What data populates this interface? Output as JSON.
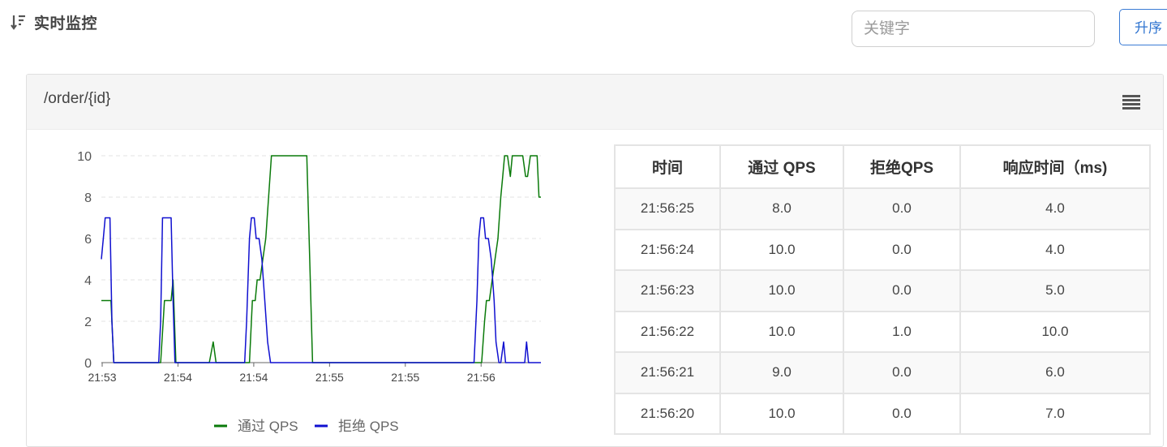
{
  "header": {
    "title": "实时监控",
    "search_placeholder": "关键字",
    "sort_label": "升序"
  },
  "card": {
    "title": "/order/{id}"
  },
  "table": {
    "columns": [
      "时间",
      "通过 QPS",
      "拒绝QPS",
      "响应时间（ms)"
    ],
    "rows": [
      [
        "21:56:25",
        "8.0",
        "0.0",
        "4.0"
      ],
      [
        "21:56:24",
        "10.0",
        "0.0",
        "4.0"
      ],
      [
        "21:56:23",
        "10.0",
        "0.0",
        "5.0"
      ],
      [
        "21:56:22",
        "10.0",
        "1.0",
        "10.0"
      ],
      [
        "21:56:21",
        "9.0",
        "0.0",
        "6.0"
      ],
      [
        "21:56:20",
        "10.0",
        "0.0",
        "7.0"
      ]
    ]
  },
  "chart_data": {
    "type": "line",
    "x_tick_labels": [
      "21:53",
      "21:54",
      "21:54",
      "21:55",
      "21:55",
      "21:56"
    ],
    "x_range": [
      0,
      46
    ],
    "ylim": [
      0,
      10
    ],
    "y_ticks": [
      0,
      2,
      4,
      6,
      8,
      10
    ],
    "grid": "horizontal dashed",
    "legend_position": "bottom",
    "series": [
      {
        "name": "通过 QPS",
        "color": "#0a7a0a",
        "x": [
          0,
          0.4,
          0.7,
          1,
          1.3,
          1.6,
          6,
          6.2,
          6.6,
          6.9,
          7.1,
          7.3,
          7.5,
          7.8,
          8.0,
          8.3,
          8.5,
          11,
          11.3,
          11.7,
          12.0,
          12.3,
          15,
          15.2,
          15.5,
          15.8,
          16.1,
          16.3,
          16.6,
          16.9,
          17.2,
          17.5,
          17.8,
          18.1,
          18.4,
          18.7,
          19.0,
          19.2,
          21.2,
          21.5,
          21.8,
          22.1,
          22.3,
          22.6,
          39,
          39.2,
          39.5,
          39.8,
          40.1,
          40.3,
          40.6,
          40.9,
          41.2,
          41.5,
          41.8,
          42.0,
          42.2,
          42.5,
          42.8,
          43.0,
          43.2,
          43.5,
          43.7,
          43.9,
          44.1,
          44.4,
          44.6,
          44.9,
          45.1,
          45.3,
          45.6,
          45.8,
          46
        ],
        "values": [
          3,
          3,
          3,
          3,
          0,
          0,
          0,
          0,
          3,
          3,
          3,
          3,
          4,
          0,
          0,
          0,
          0,
          0,
          0,
          1,
          0,
          0,
          0,
          0,
          0,
          3,
          3,
          4,
          4,
          5,
          6,
          8,
          10,
          10,
          10,
          10,
          10,
          10,
          10,
          10,
          5,
          0,
          0,
          0,
          0,
          0,
          0,
          0,
          2,
          3,
          3,
          4,
          5,
          6,
          8,
          9,
          10,
          10,
          9,
          10,
          10,
          10,
          10,
          10,
          10,
          9,
          9,
          10,
          10,
          10,
          10,
          8,
          8
        ]
      },
      {
        "name": "拒绝 QPS",
        "color": "#1010d0",
        "x": [
          0,
          0.2,
          0.4,
          0.6,
          0.9,
          1.1,
          1.3,
          1.5,
          1.8,
          6,
          6.2,
          6.4,
          6.6,
          7.1,
          7.3,
          7.5,
          7.7,
          7.9,
          15,
          15.2,
          15.5,
          15.7,
          16.0,
          16.2,
          16.5,
          16.8,
          17.1,
          17.4,
          17.7,
          18.0,
          39,
          39.3,
          39.5,
          39.7,
          40.0,
          40.2,
          40.5,
          40.8,
          41.1,
          41.3,
          41.6,
          41.8,
          42.1,
          42.3,
          42.6,
          44.1,
          44.3,
          44.5,
          44.7,
          44.9,
          45.1,
          45.3,
          46
        ],
        "values": [
          5,
          6,
          7,
          7,
          7,
          2,
          0,
          0,
          0,
          0,
          2,
          7,
          7,
          7,
          7,
          3,
          0,
          0,
          0,
          2,
          6,
          7,
          7,
          6,
          6,
          5,
          3,
          1,
          0,
          0,
          0,
          3,
          6,
          7,
          7,
          6,
          6,
          5,
          3,
          1,
          0,
          0,
          1,
          0,
          0,
          0,
          0,
          1,
          0,
          0,
          0,
          0,
          0
        ]
      }
    ]
  }
}
